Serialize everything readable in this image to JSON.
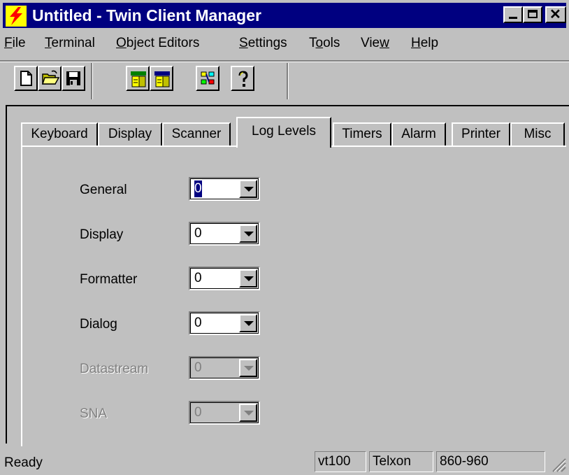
{
  "window": {
    "title": "Untitled - Twin Client Manager",
    "icon": "lightning-bolt-icon"
  },
  "menu": [
    {
      "label": "File",
      "mnemonic": "F",
      "rest": "ile"
    },
    {
      "label": "Terminal",
      "mnemonic": "T",
      "rest": "erminal"
    },
    {
      "label": "Object Editors",
      "mnemonic": "O",
      "rest": "bject Editors"
    },
    {
      "label": "Settings",
      "mnemonic": "S",
      "rest": "ettings"
    },
    {
      "label": "Tools",
      "pre": "T",
      "mnemonic": "o",
      "rest": "ols"
    },
    {
      "label": "View",
      "pre": "Vie",
      "mnemonic": "w",
      "rest": ""
    },
    {
      "label": "Help",
      "mnemonic": "H",
      "rest": "elp"
    }
  ],
  "toolbar": {
    "buttons": [
      "new-file-icon",
      "open-folder-icon",
      "save-icon",
      "terminal-view-icon",
      "terminal-setup-icon",
      "object-editor-icon",
      "help-icon"
    ]
  },
  "tabs": [
    {
      "label": "Keyboard"
    },
    {
      "label": "Display"
    },
    {
      "label": "Scanner"
    },
    {
      "label": "Log Levels",
      "active": true
    },
    {
      "label": "Timers"
    },
    {
      "label": "Alarm"
    },
    {
      "label": "Printer"
    },
    {
      "label": "Misc"
    }
  ],
  "log_levels": [
    {
      "label": "General",
      "value": "0",
      "enabled": true,
      "focused": true
    },
    {
      "label": "Display",
      "value": "0",
      "enabled": true
    },
    {
      "label": "Formatter",
      "value": "0",
      "enabled": true
    },
    {
      "label": "Dialog",
      "value": "0",
      "enabled": true
    },
    {
      "label": "Datastream",
      "value": "0",
      "enabled": false
    },
    {
      "label": "SNA",
      "value": "0",
      "enabled": false
    }
  ],
  "status": {
    "text": "Ready",
    "panes": [
      "vt100",
      "Telxon",
      "860-960",
      ""
    ]
  },
  "colors": {
    "titlebar": "#000080",
    "face": "#c0c0c0",
    "disabled_text": "#808080"
  }
}
